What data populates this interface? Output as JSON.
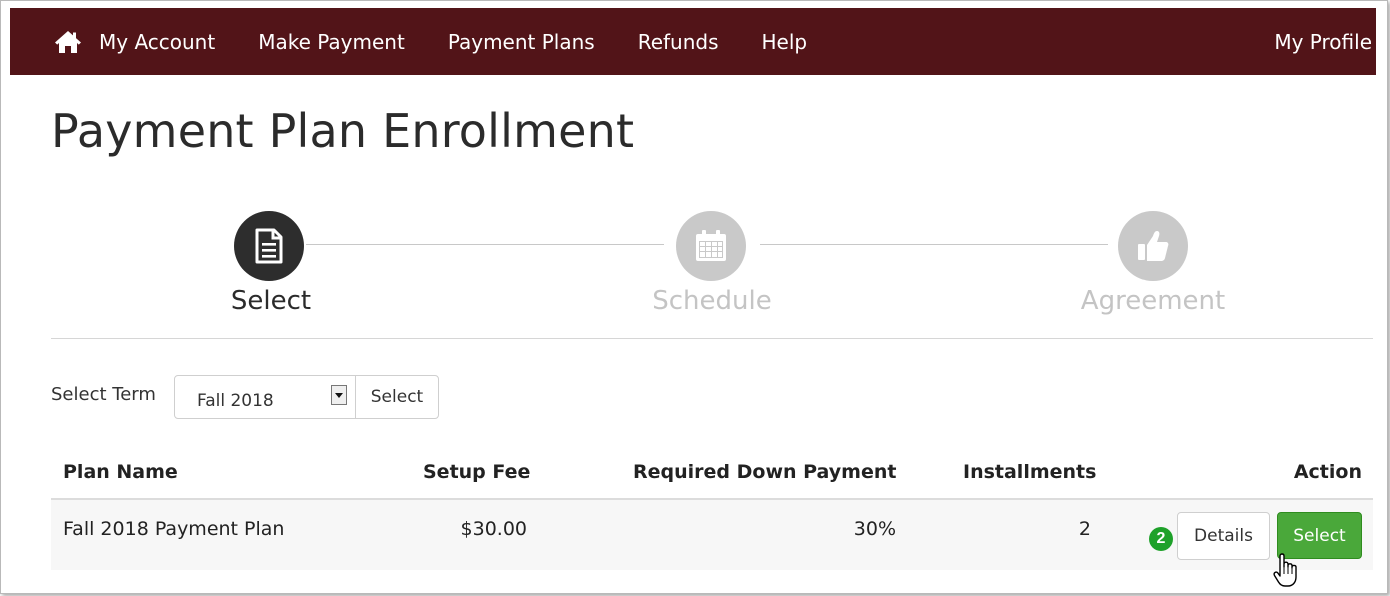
{
  "nav": {
    "items": [
      {
        "label": "My Account"
      },
      {
        "label": "Make Payment"
      },
      {
        "label": "Payment Plans"
      },
      {
        "label": "Refunds"
      },
      {
        "label": "Help"
      }
    ],
    "profile_label": "My Profile",
    "home_icon": "home-icon"
  },
  "page": {
    "title": "Payment Plan Enrollment"
  },
  "steps": [
    {
      "label": "Select",
      "icon": "document-icon",
      "active": true
    },
    {
      "label": "Schedule",
      "icon": "calendar-icon",
      "active": false
    },
    {
      "label": "Agreement",
      "icon": "thumbs-up-icon",
      "active": false
    }
  ],
  "term": {
    "label": "Select Term",
    "selected": "Fall 2018",
    "button_label": "Select"
  },
  "table": {
    "headers": {
      "plan_name": "Plan Name",
      "setup_fee": "Setup Fee",
      "down_payment": "Required Down Payment",
      "installments": "Installments",
      "action": "Action"
    },
    "rows": [
      {
        "plan_name": "Fall 2018 Payment Plan",
        "setup_fee": "$30.00",
        "down_payment": "30%",
        "installments": "2",
        "details_label": "Details",
        "select_label": "Select"
      }
    ]
  },
  "annotation": {
    "badge": "2"
  },
  "colors": {
    "nav_bg": "#521418",
    "active_step": "#2d2d2d",
    "inactive_step": "#c9c9c9",
    "select_button": "#4aa83a",
    "badge": "#1ea12a"
  }
}
